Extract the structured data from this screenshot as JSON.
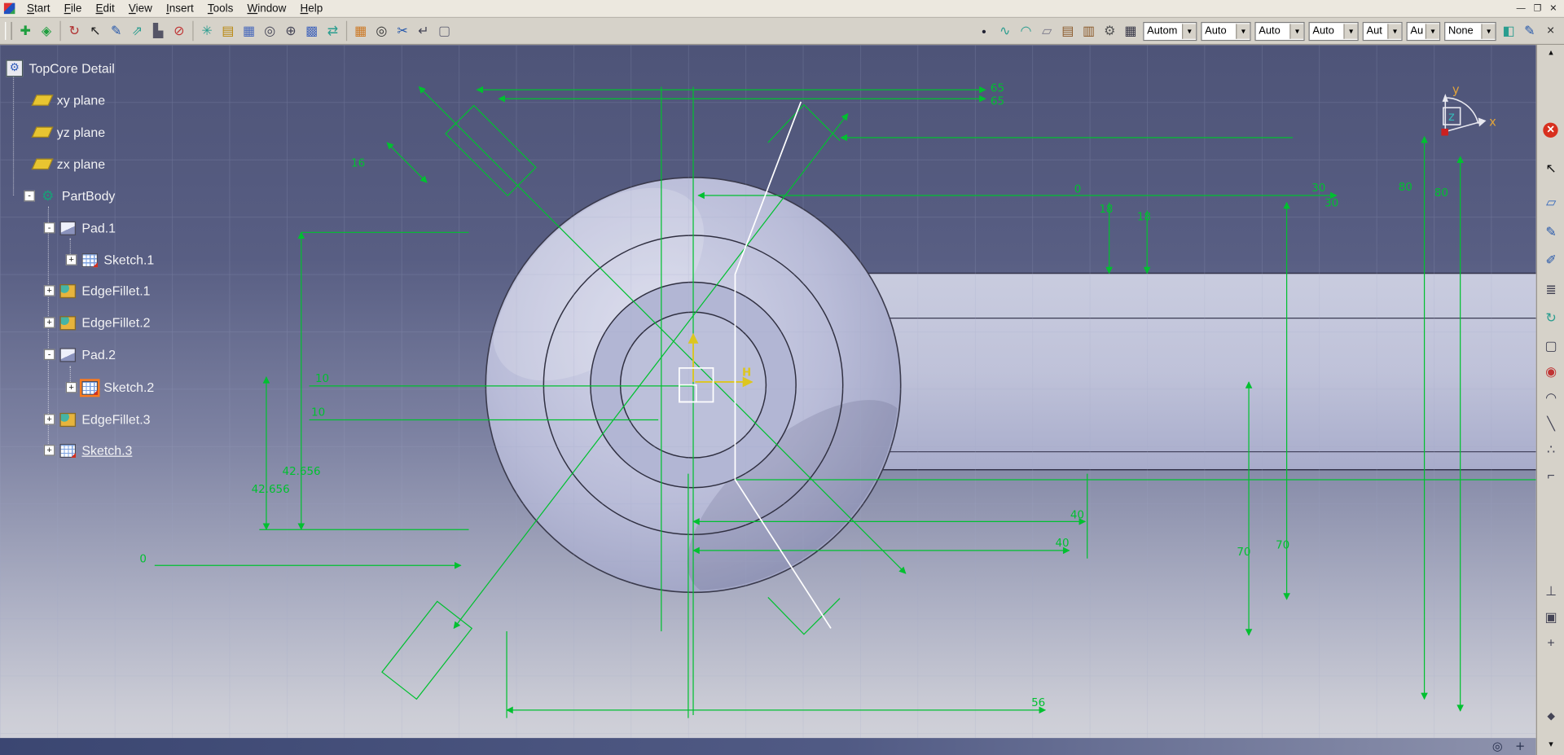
{
  "window_controls": {
    "minimize": "—",
    "maximize": "❐",
    "close": "✕",
    "doc_close": "✕"
  },
  "menu": {
    "items": [
      "Start",
      "File",
      "Edit",
      "View",
      "Insert",
      "Tools",
      "Window",
      "Help"
    ]
  },
  "toolbar": {
    "dropdown_arrow": "▾",
    "left_icons": [
      {
        "name": "pan-icon",
        "glyph": "✚"
      },
      {
        "name": "iso-view-icon",
        "glyph": "◈"
      },
      {
        "name": "rotate-view-icon",
        "glyph": "↻"
      },
      {
        "name": "select-arrow-icon",
        "glyph": "↖"
      },
      {
        "name": "sketcher-icon",
        "glyph": "✎"
      },
      {
        "name": "arrow-ne-icon",
        "glyph": "⇗"
      },
      {
        "name": "levels-icon",
        "glyph": "▙"
      },
      {
        "name": "snap-icon",
        "glyph": "⊘"
      },
      {
        "name": "construction-icon",
        "glyph": "✳"
      },
      {
        "name": "folder-icon",
        "glyph": "▤"
      },
      {
        "name": "grid-icon",
        "glyph": "▦"
      },
      {
        "name": "zoom-area-icon",
        "glyph": "◎"
      },
      {
        "name": "target-icon",
        "glyph": "⊕"
      },
      {
        "name": "sketch-grid-icon",
        "glyph": "▩"
      },
      {
        "name": "swap-visible-icon",
        "glyph": "⇄"
      },
      {
        "name": "grid-snap-icon",
        "glyph": "▦"
      },
      {
        "name": "magnify-icon",
        "glyph": "◎"
      },
      {
        "name": "trim-icon",
        "glyph": "✂"
      },
      {
        "name": "return-icon",
        "glyph": "↵"
      },
      {
        "name": "dashed-box-icon",
        "glyph": "▢"
      }
    ],
    "right_icons": [
      {
        "name": "point-icon",
        "glyph": "•"
      },
      {
        "name": "spline-icon",
        "glyph": "∿"
      },
      {
        "name": "arc-icon",
        "glyph": "◠"
      },
      {
        "name": "quad-icon",
        "glyph": "▱"
      },
      {
        "name": "catalog-icon",
        "glyph": "▤"
      },
      {
        "name": "book-icon",
        "glyph": "▥"
      },
      {
        "name": "gear-pencil-icon",
        "glyph": "⚙"
      },
      {
        "name": "table-icon",
        "glyph": "▦"
      }
    ],
    "combos": [
      {
        "value": "Autom"
      },
      {
        "value": "Auto"
      },
      {
        "value": "Auto"
      },
      {
        "value": "Auto"
      },
      {
        "value": "Aut"
      },
      {
        "value": "Au"
      },
      {
        "value": "None"
      }
    ],
    "trailing_icons": [
      {
        "name": "paint-icon",
        "glyph": "◧"
      },
      {
        "name": "edit-pencil-icon",
        "glyph": "✎"
      }
    ]
  },
  "tree": {
    "items": [
      {
        "label": "TopCore Detail",
        "glyph": "⚙"
      },
      {
        "label": "xy plane"
      },
      {
        "label": "yz plane"
      },
      {
        "label": "zx plane"
      },
      {
        "label": "PartBody",
        "expand": "-",
        "glyph": "⚙"
      },
      {
        "label": "Pad.1",
        "expand": "-"
      },
      {
        "label": "Sketch.1",
        "expand": "+"
      },
      {
        "label": "EdgeFillet.1",
        "expand": "+"
      },
      {
        "label": "EdgeFillet.2",
        "expand": "+"
      },
      {
        "label": "Pad.2",
        "expand": "-"
      },
      {
        "label": "Sketch.2",
        "expand": "+"
      },
      {
        "label": "EdgeFillet.3",
        "expand": "+"
      },
      {
        "label": "Sketch.3",
        "expand": "+"
      }
    ]
  },
  "viewport": {
    "h_axis_label": "H",
    "compass": {
      "x": "x",
      "y": "y",
      "z": "z"
    },
    "corner_icons": [
      {
        "name": "axis-target-icon",
        "glyph": "◎"
      },
      {
        "name": "axis-cross-icon",
        "glyph": "+"
      }
    ],
    "dims": [
      {
        "text": "65"
      },
      {
        "text": "65"
      },
      {
        "text": "16"
      },
      {
        "text": "0"
      },
      {
        "text": "30"
      },
      {
        "text": "30"
      },
      {
        "text": "18"
      },
      {
        "text": "18"
      },
      {
        "text": "80"
      },
      {
        "text": "80"
      },
      {
        "text": "10"
      },
      {
        "text": "10"
      },
      {
        "text": "42.656"
      },
      {
        "text": "42.656"
      },
      {
        "text": "40"
      },
      {
        "text": "40"
      },
      {
        "text": "70"
      },
      {
        "text": "70"
      },
      {
        "text": "0"
      },
      {
        "text": "56"
      }
    ]
  },
  "right_toolbar": {
    "icons": [
      {
        "name": "scroll-up-icon",
        "glyph": "▴"
      },
      {
        "name": "exit-workbench-icon",
        "glyph": "✕"
      },
      {
        "name": "select-cursor-icon",
        "glyph": "↖"
      },
      {
        "name": "plane-icon",
        "glyph": "▱"
      },
      {
        "name": "pencil-icon",
        "glyph": "✎"
      },
      {
        "name": "pen-icon",
        "glyph": "✐"
      },
      {
        "name": "layers-icon",
        "glyph": "≣"
      },
      {
        "name": "rotate-icon",
        "glyph": "↻"
      },
      {
        "name": "box-icon",
        "glyph": "▢"
      },
      {
        "name": "point-icon",
        "glyph": "◉"
      },
      {
        "name": "arc-icon",
        "glyph": "◠"
      },
      {
        "name": "line-icon",
        "glyph": "╲"
      },
      {
        "name": "points-icon",
        "glyph": "∴"
      },
      {
        "name": "profile-icon",
        "glyph": "⌐"
      },
      {
        "name": "constraint-icon",
        "glyph": "⊥"
      },
      {
        "name": "measure-icon",
        "glyph": "▣"
      },
      {
        "name": "axis-icon",
        "glyph": "+"
      },
      {
        "name": "diamond-icon",
        "glyph": "◆"
      },
      {
        "name": "scroll-down-icon",
        "glyph": "▾"
      }
    ]
  },
  "colors": {
    "sketch_green": "#00c030",
    "axis_yellow": "#ddc61f",
    "part_fill": "#b9bcd8",
    "bg_top": "#4e5478",
    "bg_bottom": "#d2d3da",
    "selection_orange": "#ff7a1a",
    "exit_red": "#d8301e"
  }
}
